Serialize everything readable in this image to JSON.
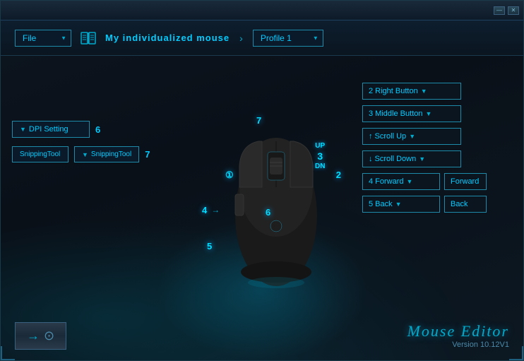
{
  "app": {
    "title": "Mouse Editor",
    "version": "Version 10.12V1"
  },
  "window": {
    "minimize_label": "—",
    "close_label": "✕"
  },
  "header": {
    "file_label": "File",
    "book_icon": "book-icon",
    "profile_section_label": "My individualized mouse",
    "arrow_label": "›",
    "profile_dropdown_label": "Profile 1"
  },
  "left_panel": {
    "dpi_label": "DPI Setting",
    "dpi_number": "6",
    "snipping_btn1": "SnippingTool",
    "snipping_btn2": "SnippingTool",
    "snipping_num": "7",
    "label4": "4",
    "label5": "5"
  },
  "mouse_labels": {
    "label1": "①",
    "label2": "2",
    "label3": "3",
    "label6": "6",
    "label7": "7",
    "scroll_up": "UP",
    "scroll_down": "DN"
  },
  "right_panel": {
    "mappings": [
      {
        "id": 0,
        "label": "2 Right Button",
        "value": "",
        "has_extra": false
      },
      {
        "id": 1,
        "label": "3 Middle Button",
        "value": "",
        "has_extra": false
      },
      {
        "id": 2,
        "label": "↑ Scroll Up",
        "value": "",
        "has_extra": false
      },
      {
        "id": 3,
        "label": "↓ Scroll Down",
        "value": "",
        "has_extra": false
      },
      {
        "id": 4,
        "label": "4 Forward",
        "value": "Forward",
        "has_extra": true
      },
      {
        "id": 5,
        "label": "5 Back",
        "value": "Back",
        "has_extra": true
      }
    ]
  },
  "bottom": {
    "nav_arrow": "→⊙",
    "brand": "Mouse Editor",
    "version": "Version 10.12V1"
  }
}
